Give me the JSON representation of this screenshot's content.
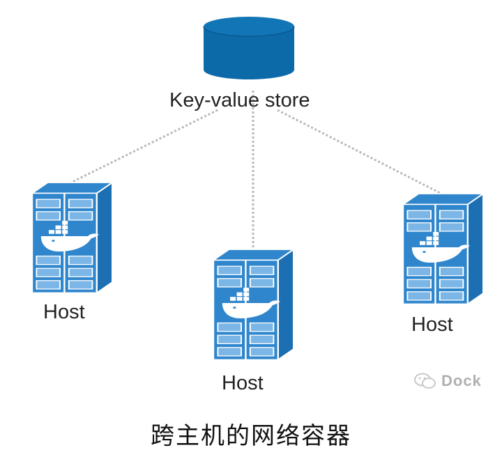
{
  "store": {
    "label": "Key-value store"
  },
  "hosts": [
    {
      "label": "Host"
    },
    {
      "label": "Host"
    },
    {
      "label": "Host"
    }
  ],
  "watermark": {
    "text": "Dock",
    "icon": "wechat-icon"
  },
  "caption": "跨主机的网络容器",
  "colors": {
    "primary": "#0d6aa8",
    "server_front": "#2f86cc",
    "server_side": "#1c6fb3",
    "drawer": "#7cb6e6",
    "link": "#b8b8b8"
  }
}
